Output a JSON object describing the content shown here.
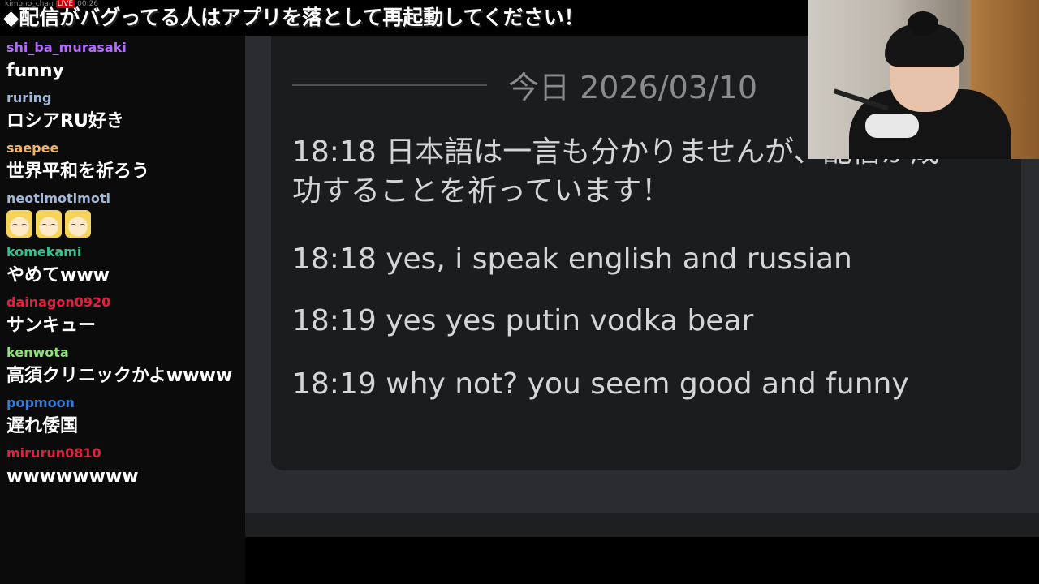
{
  "banner": {
    "peek_text_left": "kimono_chan",
    "peek_live": "LIVE",
    "peek_time": "00:26",
    "title": "◆配信がバグってる人はアプリを落として再起動してください！"
  },
  "chat": {
    "messages": [
      {
        "user": "shi_ba_murasaki",
        "color": "#b36bff",
        "text": "funny"
      },
      {
        "user": "ruring",
        "color": "#9fb8d8",
        "text": "ロシアRU好き"
      },
      {
        "user": "saepee",
        "color": "#f0b36a",
        "text": "世界平和を祈ろう"
      },
      {
        "user": "neotimotimoti",
        "color": "#9fb8d8",
        "emotes": 3
      },
      {
        "user": "komekami",
        "color": "#35c28e",
        "text": "やめてwww"
      },
      {
        "user": "dainagon0920",
        "color": "#e0203c",
        "text": "サンキュー"
      },
      {
        "user": "kenwota",
        "color": "#8ee07a",
        "text": "高須クリニックかよwwww"
      },
      {
        "user": "popmoon",
        "color": "#3a7bd5",
        "text": "遅れ倭国"
      },
      {
        "user": "mirurun0810",
        "color": "#e0203c",
        "text": "wwwwwwww"
      }
    ]
  },
  "screen": {
    "date": "今日 2026/03/10",
    "lines": [
      "18:18 日本語は一言も分かりませんが、配信が成功することを祈っています！",
      "18:18 yes, i speak english and russian",
      "18:19 yes yes putin vodka bear",
      "18:19 why not? you seem good and funny"
    ]
  },
  "colors": {
    "chat_bg": "#0b0b0b",
    "screen_bg": "#2b2c2f",
    "panel_bg": "#1b1c1e",
    "message_text": "#d4d5d7",
    "date_text": "#8a8b8e"
  }
}
